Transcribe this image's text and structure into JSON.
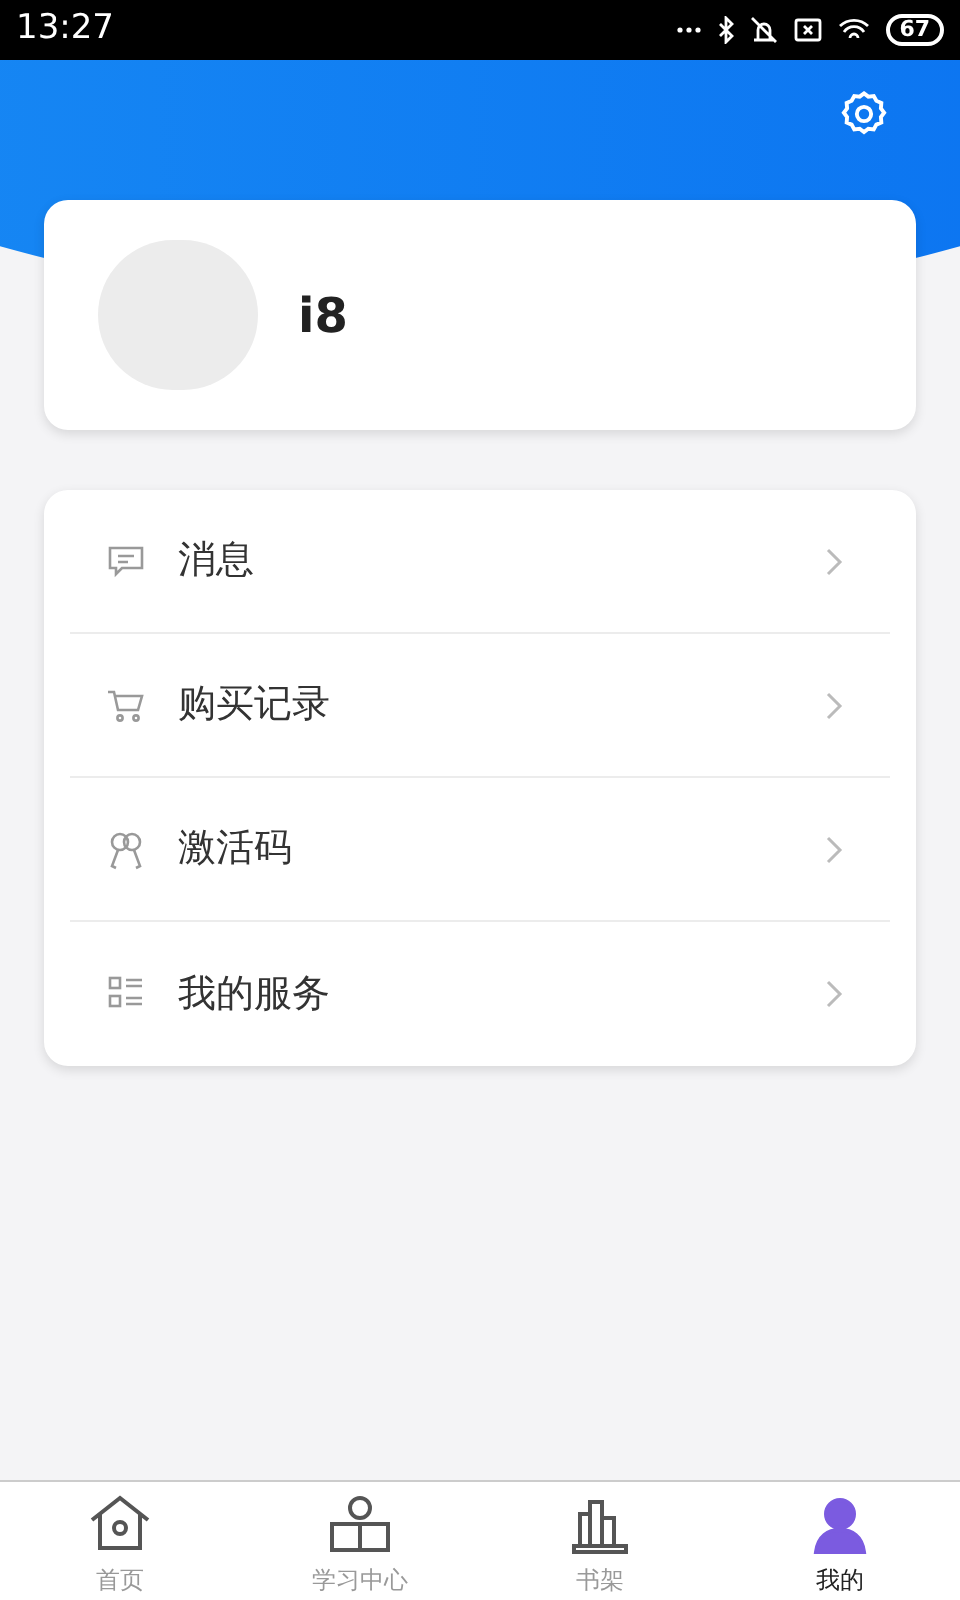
{
  "status_bar": {
    "time": "13:27",
    "battery": "67"
  },
  "profile": {
    "username": "i8"
  },
  "menu": [
    {
      "kind": "message",
      "label": "消息"
    },
    {
      "kind": "cart",
      "label": "购买记录"
    },
    {
      "kind": "key",
      "label": "激活码"
    },
    {
      "kind": "service",
      "label": "我的服务"
    }
  ],
  "tab_bar": [
    {
      "kind": "home",
      "label": "首页",
      "selected": false
    },
    {
      "kind": "study",
      "label": "学习中心",
      "selected": false
    },
    {
      "kind": "shelf",
      "label": "书架",
      "selected": false
    },
    {
      "kind": "me",
      "label": "我的",
      "selected": true
    }
  ]
}
